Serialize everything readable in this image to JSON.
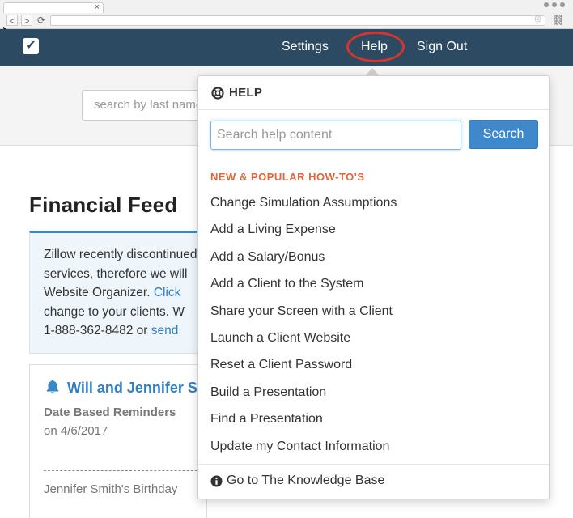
{
  "browser": {
    "tab_close": "×",
    "back": "<",
    "forward": ">",
    "reload": "⟳"
  },
  "header": {
    "logo": "✔",
    "nav": {
      "settings": "Settings",
      "help": "Help",
      "sign_out": "Sign Out"
    }
  },
  "search": {
    "placeholder": "search by last name"
  },
  "main": {
    "title": "Financial Feed",
    "alert": {
      "line1": "Zillow recently discontinued",
      "line2": "services, therefore we will",
      "line3_text": "Website Organizer. ",
      "line3_link": "Click",
      "line4": "change to your clients. W",
      "line5_text": "1-888-362-8482 or ",
      "line5_link": "send"
    },
    "card": {
      "title": "Will and Jennifer Smith",
      "subtitle": "Date Based Reminders",
      "date": "on 4/6/2017",
      "birthday": "Jennifer Smith's Birthday"
    }
  },
  "help": {
    "heading": "HELP",
    "search_placeholder": "Search help content",
    "search_button": "Search",
    "howto_heading": "NEW & POPULAR HOW-TO'S",
    "items": [
      "Change Simulation Assumptions",
      "Add a Living Expense",
      "Add a Salary/Bonus",
      "Add a Client to the System",
      "Share your Screen with a Client",
      "Launch a Client Website",
      "Reset a Client Password",
      "Build a Presentation",
      "Find a Presentation",
      "Update my Contact Information"
    ],
    "kb_link": "Go to The Knowledge Base"
  },
  "colors": {
    "header_bg": "#2c4b63",
    "accent_blue": "#3f88cc",
    "howto_orange": "#e0663a",
    "highlight_red": "#d9342b"
  }
}
